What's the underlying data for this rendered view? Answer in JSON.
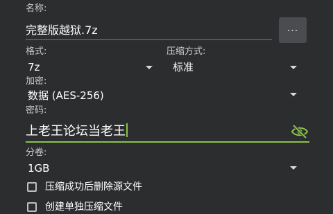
{
  "form": {
    "name_label": "名称:",
    "name_value": "完整版越狱.7z",
    "browse_label": "...",
    "format_label": "格式:",
    "format_value": "7z",
    "method_label": "压缩方式:",
    "method_value": "标准",
    "encryption_label": "加密:",
    "encryption_value": "数据 (AES-256)",
    "password_label": "密码:",
    "password_value": "上老王论坛当老王",
    "split_label": "分卷:",
    "split_value": "1GB",
    "delete_source_label": "压缩成功后删除源文件",
    "second_option_label": "创建单独压缩文件"
  },
  "icons": {
    "visibility": "eye-off-icon",
    "dropdown": "triangle-down-icon"
  },
  "colors": {
    "background": "#2b2d2f",
    "accent": "#8bc34a",
    "text": "#ffffff",
    "label": "#c9cbcd"
  }
}
